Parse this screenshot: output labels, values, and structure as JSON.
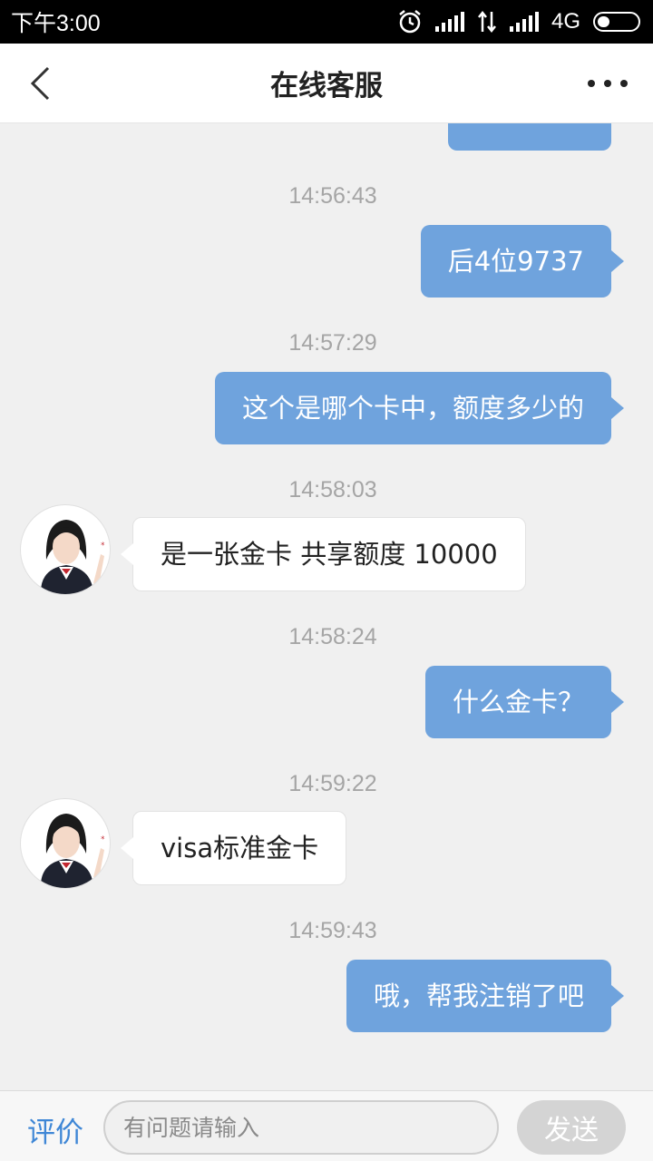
{
  "status_bar": {
    "time": "下午3:00",
    "network": "4G"
  },
  "header": {
    "title": "在线客服"
  },
  "messages": [
    {
      "time": "14:56:43",
      "from": "user",
      "text": "后4位9737"
    },
    {
      "time": "14:57:29",
      "from": "user",
      "text": "这个是哪个卡中，额度多少的"
    },
    {
      "time": "14:58:03",
      "from": "agent",
      "text": "是一张金卡 共享额度 10000"
    },
    {
      "time": "14:58:24",
      "from": "user",
      "text": "什么金卡？"
    },
    {
      "time": "14:59:22",
      "from": "agent",
      "text": "visa标准金卡"
    },
    {
      "time": "14:59:43",
      "from": "user",
      "text": "哦，帮我注销了吧"
    }
  ],
  "footer": {
    "rate_label": "评价",
    "input_placeholder": "有问题请输入",
    "input_value": "",
    "send_label": "发送"
  },
  "colors": {
    "user_bubble": "#6fa3dd",
    "agent_bubble": "#ffffff",
    "accent": "#3f87d6",
    "send_disabled": "#d4d4d4"
  }
}
